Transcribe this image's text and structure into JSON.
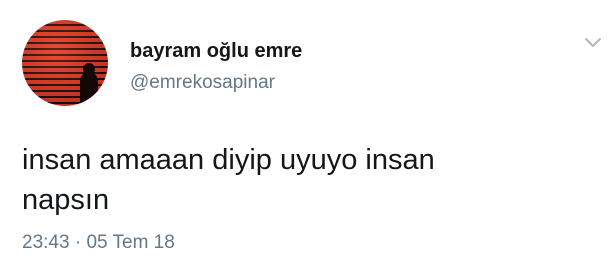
{
  "tweet": {
    "display_name": "bayram oğlu emre",
    "handle": "@emrekosapinar",
    "text_lines": [
      "insan amaaan diyip uyuyo insan",
      "napsın"
    ],
    "time": "23:43",
    "separator": "·",
    "date": "05 Tem 18"
  },
  "icons": {
    "menu": "chevron-down-icon"
  },
  "colors": {
    "avatar_red": "#e23a2a",
    "secondary_text": "#657786",
    "primary_text": "#14171a"
  }
}
